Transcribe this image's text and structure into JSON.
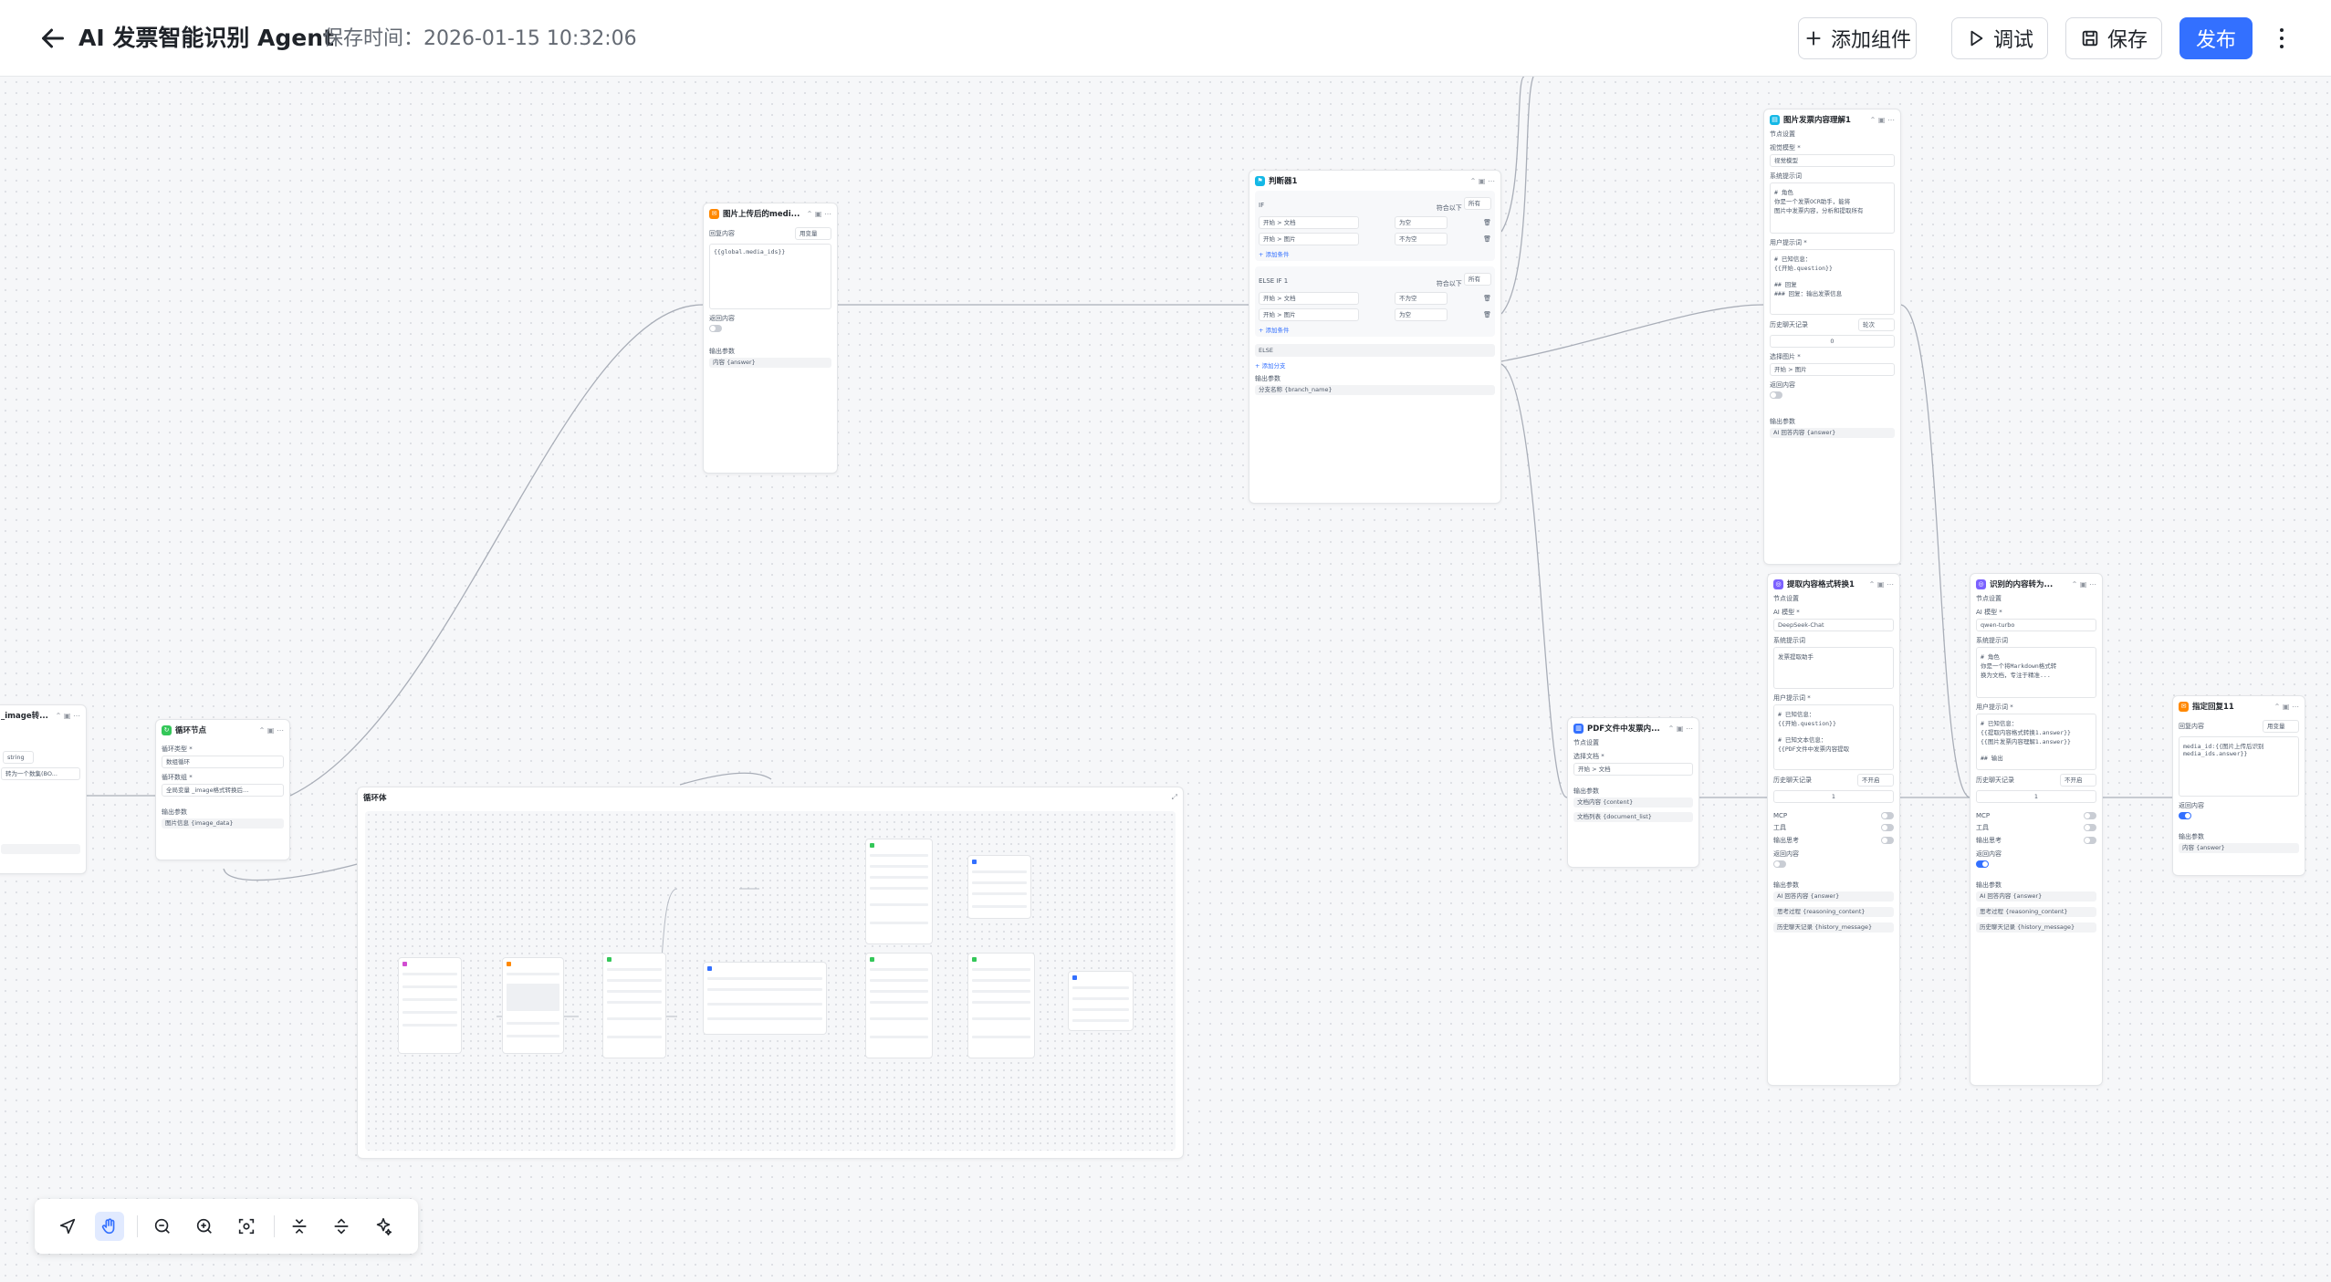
{
  "header": {
    "title": "AI 发票智能识别 Agent",
    "save_time": "保存时间：2026-01-15 10:32:06",
    "buttons": {
      "add_component": "添加组件",
      "debug": "调试",
      "save": "保存",
      "publish": "发布"
    }
  },
  "colors": {
    "accent": "#3370ff",
    "green": "#34c759",
    "orange": "#ff8800",
    "purple": "#7b61ff",
    "cyan": "#14b8e6"
  },
  "nodes": {
    "left_partial": {
      "title": "_image转...",
      "tag": "string",
      "field": "转为一个数集(BO...",
      "output": ""
    },
    "loop_node": {
      "title": "循环节点",
      "loop_type_label": "循环类型 *",
      "loop_type": "数组循环",
      "loop_array_label": "循环数组 *",
      "loop_array": "全局变量 _image格式转换后...",
      "output_label": "输出参数",
      "output": "图片信息 {image_data}"
    },
    "loop_body": {
      "title": "循环体"
    },
    "img_upload": {
      "title": "图片上传后的medi...",
      "reply_label": "回复内容",
      "reply_mode": "用变量",
      "reply_value": "{{global.media_ids}}",
      "return_label": "返回内容",
      "output_label": "输出参数",
      "output": "内容 {answer}"
    },
    "judge": {
      "title": "判断器1",
      "if_label": "IF",
      "meet": "符合以下",
      "any": "所有",
      "cond1_field": "开始 > 文档",
      "cond1_op": "为空",
      "cond2_field": "开始 > 图片",
      "cond2_op": "不为空",
      "add_cond": "+ 添加条件",
      "elseif_label": "ELSE IF 1",
      "cond3_field": "开始 > 文档",
      "cond3_op": "不为空",
      "cond4_field": "开始 > 图片",
      "cond4_op": "为空",
      "add_cond2": "+ 添加条件",
      "else_label": "ELSE",
      "add_branch": "+ 添加分支",
      "output_label": "输出参数",
      "output": "分支名称 {branch_name}"
    },
    "img_understand": {
      "title": "图片发票内容理解1",
      "section": "节点设置",
      "model_label": "视觉模型 *",
      "model": "视觉模型",
      "sys_label": "系统提示词",
      "sys_text": "# 角色\n你是一个发票OCR助手，能将\n图片中发票内容，分析和提取所有",
      "user_label": "用户提示词 *",
      "user_text": "# 已知信息：\n{{开始.question}}\n\n## 回复\n### 回复：输出发票信息",
      "history_label": "历史聊天记录",
      "history_mode": "轮次",
      "history_val": "0",
      "pick_label": "选择图片 *",
      "pick": "开始 > 图片",
      "return_label": "返回内容",
      "output_label": "输出参数",
      "output": "AI 回答内容 {answer}"
    },
    "pdf_extract": {
      "title": "PDF文件中发票内...",
      "section": "节点设置",
      "file_label": "选择文档 *",
      "file": "开始 > 文档",
      "output_label": "输出参数",
      "out1": "文档内容 {content}",
      "out2": "文档列表 {document_list}"
    },
    "format_convert": {
      "title": "提取内容格式转换1",
      "section": "节点设置",
      "model_label": "AI 模型 *",
      "model": "DeepSeek-Chat",
      "sys_label": "系统提示词",
      "sys_text": "发票提取助手",
      "user_label": "用户提示词 *",
      "user_text": "# 已知信息：\n{{开始.question}}\n\n# 已知文本信息：\n{{PDF文件中发票内容提取",
      "history_label": "历史聊天记录",
      "history_mode": "不开启",
      "history_val": "1",
      "mcp": "MCP",
      "tool": "工具",
      "think": "输出思考",
      "return_label": "返回内容",
      "output_label": "输出参数",
      "out1": "AI 回答内容 {answer}",
      "out2": "思考过程 {reasoning_content}",
      "out3": "历史聊天记录 {history_message}"
    },
    "recognize_convert": {
      "title": "识别的内容转为...",
      "section": "节点设置",
      "model_label": "AI 模型 *",
      "model": "qwen-turbo",
      "sys_label": "系统提示词",
      "sys_text": "# 角色\n你是一个将Markdown格式转\n换为文档，专注于精准...",
      "user_label": "用户提示词 *",
      "user_text": "# 已知信息：\n{{提取内容格式转换1.answer}}\n{{图片发票内容理解1.answer}}\n\n## 输出",
      "history_label": "历史聊天记录",
      "history_mode": "不开启",
      "history_val": "1",
      "mcp": "MCP",
      "tool": "工具",
      "think": "输出思考",
      "return_label": "返回内容",
      "output_label": "输出参数",
      "out1": "AI 回答内容 {answer}",
      "out2": "思考过程 {reasoning_content}",
      "out3": "历史聊天记录 {history_message}"
    },
    "designated_reply": {
      "title": "指定回复11",
      "reply_label": "回复内容",
      "reply_mode": "用变量",
      "reply_value": "media_id:{{图片上传后识别\nmedia_ids.answer}}",
      "return_label": "返回内容",
      "output_label": "输出参数",
      "output": "内容 {answer}"
    }
  },
  "toolbar": {
    "icons": [
      "navigate-icon",
      "hand-icon",
      "zoom-out-icon",
      "zoom-in-icon",
      "fit-view-icon",
      "collapse-icon",
      "expand-icon",
      "beautify-icon"
    ]
  }
}
